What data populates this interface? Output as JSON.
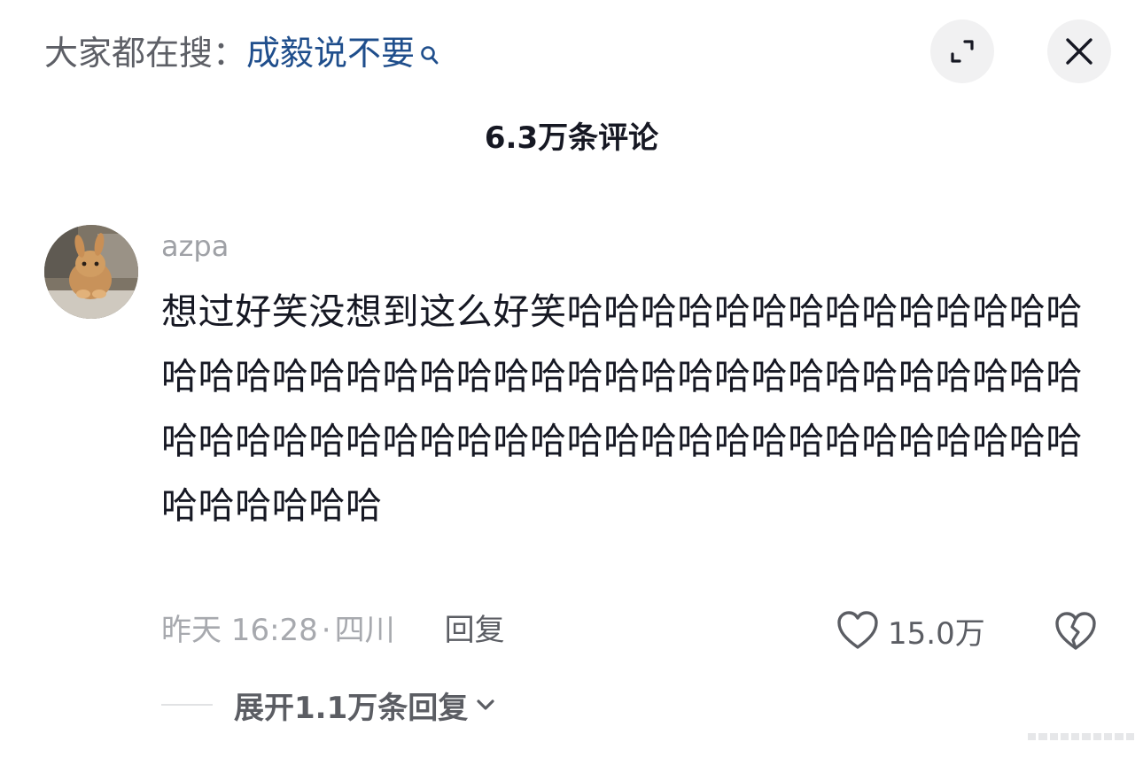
{
  "search": {
    "prefix": "大家都在搜：",
    "term": "成毅说不要",
    "icon": "search-icon"
  },
  "header": {
    "expand_icon": "expand-icon",
    "close_icon": "close-icon",
    "comments_title": "6.3万条评论"
  },
  "comment": {
    "avatar": "avatar",
    "username": "azpa",
    "text": "想过好笑没想到这么好笑哈哈哈哈哈哈哈哈哈哈哈哈哈哈哈哈哈哈哈哈哈哈哈哈哈哈哈哈哈哈哈哈哈哈哈哈哈哈哈哈哈哈哈哈哈哈哈哈哈哈哈哈哈哈哈哈哈哈哈哈哈哈哈哈哈哈哈哈哈哈",
    "time": "昨天 16:28",
    "separator": "·",
    "location": "四川",
    "reply_label": "回复",
    "like_icon": "heart-icon",
    "like_count": "15.0万",
    "dislike_icon": "broken-heart-icon"
  },
  "replies": {
    "expand_label": "展开1.1万条回复",
    "chevron_icon": "chevron-down-icon"
  },
  "colors": {
    "link_blue": "#1f4e8c",
    "muted_gray": "#a7a9ae",
    "text_dark": "#161823",
    "button_bg": "#f1f1f2"
  }
}
